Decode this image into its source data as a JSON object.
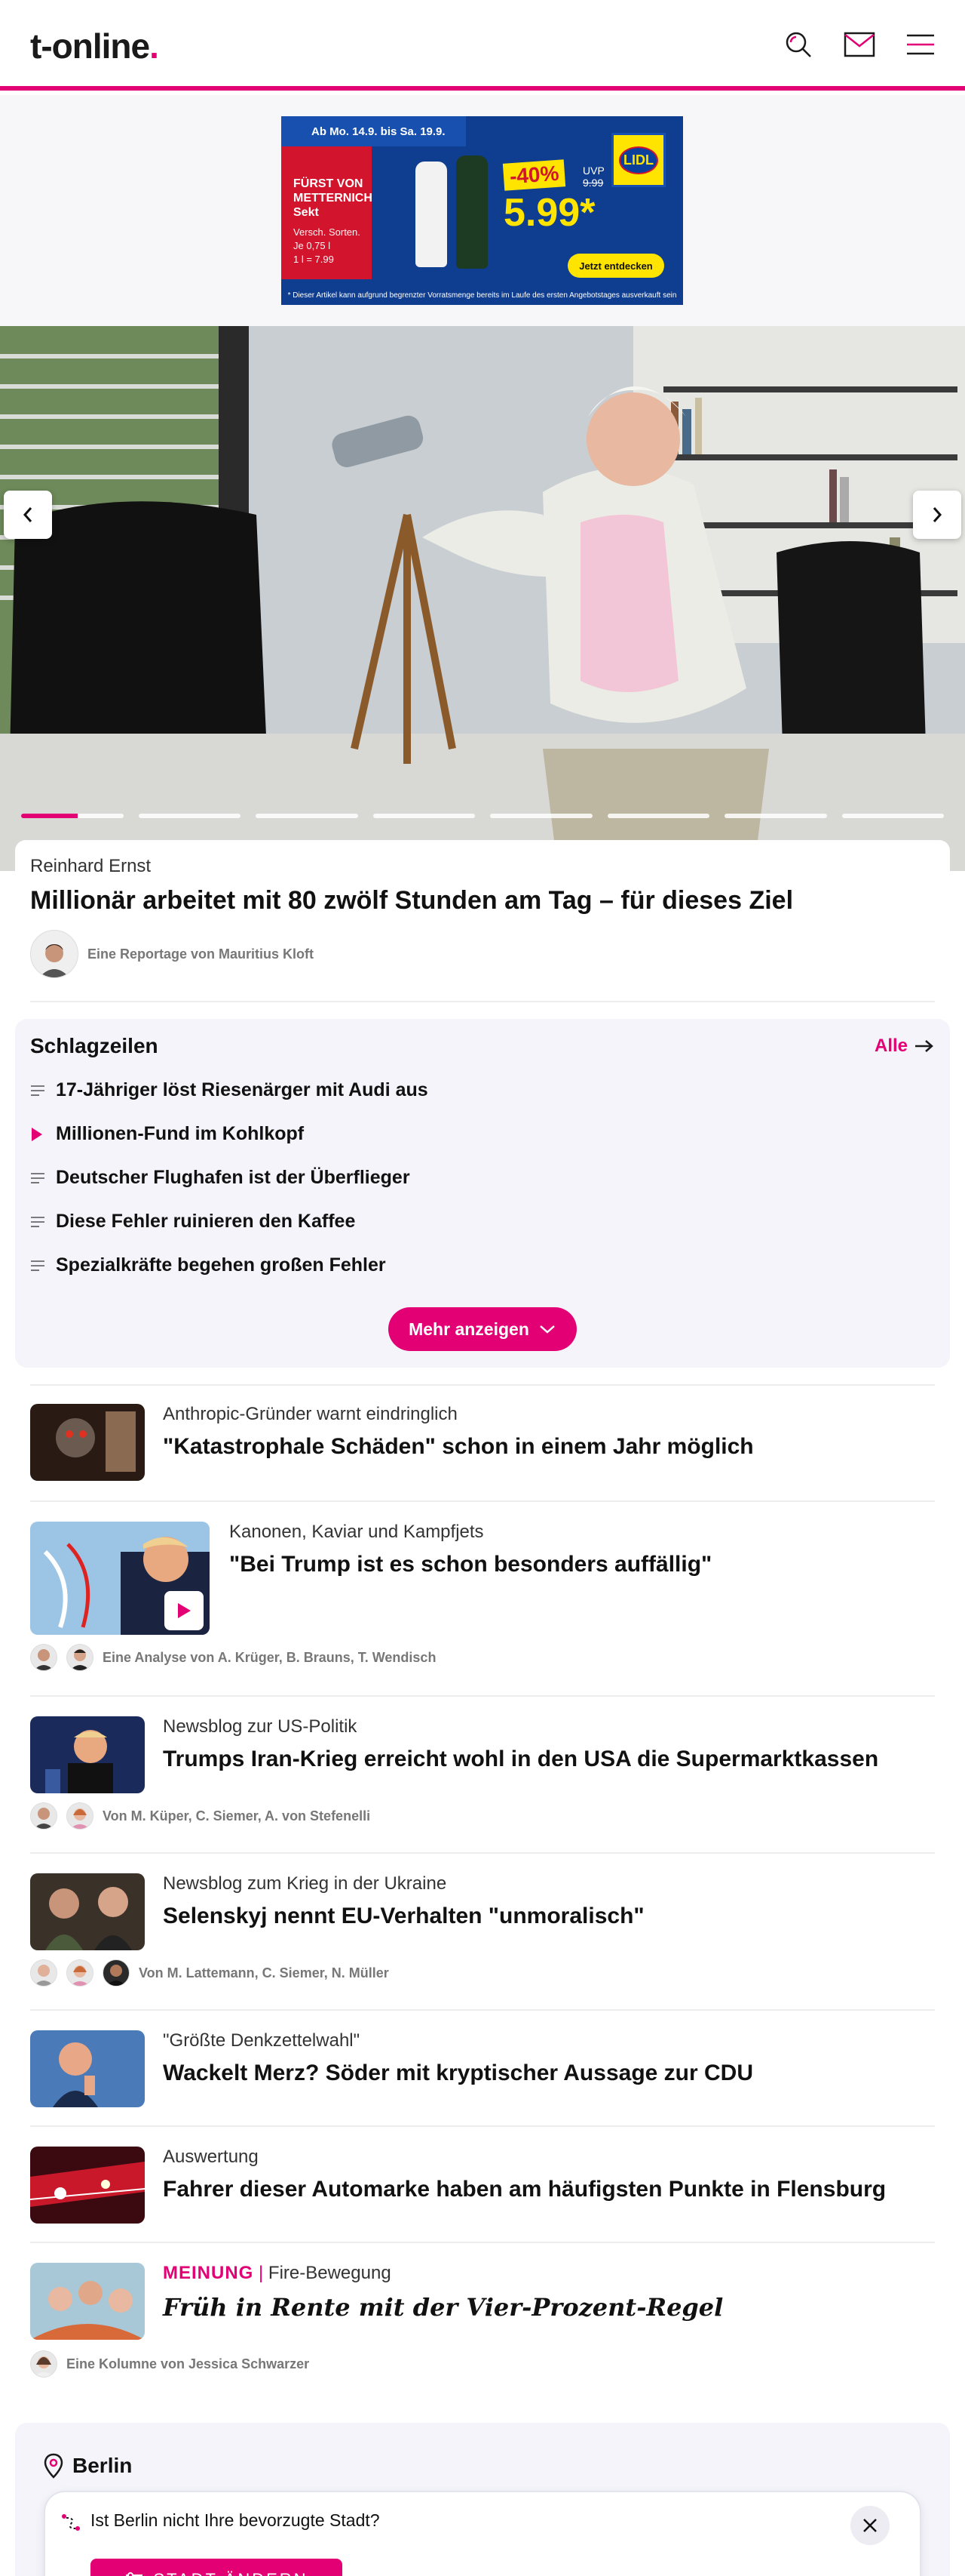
{
  "header": {
    "logo_main": "t-online",
    "logo_dot": ".",
    "icons": [
      "search-icon",
      "mail-icon",
      "menu-icon"
    ],
    "accent": "#e20074"
  },
  "ad": {
    "date_range": "Ab Mo. 14.9. bis Sa. 19.9.",
    "product_name": "FÜRST VON METTERNICH Sekt",
    "product_detail_1": "Versch. Sorten.",
    "product_detail_2": "Je 0,75 l",
    "product_detail_3": "1 l = 7.99",
    "discount": "-40%",
    "uvp_label": "UVP",
    "uvp_old": "9.99",
    "price": "5.99*",
    "brand": "LIDL",
    "cta": "Jetzt entdecken",
    "footnote": "* Dieser Artikel kann aufgrund begrenzter Vorratsmenge bereits im Laufe des ersten Angebotstages ausverkauft sein"
  },
  "hero": {
    "kicker": "Reinhard Ernst",
    "title": "Millionär arbeitet mit 80 zwölf Stunden am Tag – für dieses Ziel",
    "author": "Eine Reportage von Mauritius Kloft",
    "slide_count": 8,
    "active_slide": 1,
    "active_progress": 0.55
  },
  "schlagzeilen": {
    "title": "Schlagzeilen",
    "all_label": "Alle",
    "items": [
      {
        "label": "17-Jähriger löst Riesenärger mit Audi aus",
        "icon": "text-lines-icon"
      },
      {
        "label": "Millionen-Fund im Kohlkopf",
        "icon": "play-icon"
      },
      {
        "label": "Deutscher Flughafen ist der Überflieger",
        "icon": "text-lines-icon"
      },
      {
        "label": "Diese Fehler ruinieren den Kaffee",
        "icon": "text-lines-icon"
      },
      {
        "label": "Spezialkräfte begehen großen Fehler",
        "icon": "text-lines-icon"
      }
    ],
    "more_label": "Mehr anzeigen"
  },
  "articles": [
    {
      "kicker": "Anthropic-Gründer warnt eindringlich",
      "title": "\"Katastrophale Schäden\" schon in einem Jahr möglich"
    },
    {
      "kicker": "Kanonen, Kaviar und Kampfjets",
      "title": "\"Bei Trump ist es schon besonders auffällig\"",
      "author": "Eine Analyse von A. Krüger, B. Brauns, T. Wendisch"
    },
    {
      "kicker": "Newsblog zur US-Politik",
      "title": "Trumps Iran-Krieg erreicht wohl in den USA die Supermarktkassen",
      "author": "Von M. Küper, C. Siemer, A. von Stefenelli"
    },
    {
      "kicker": "Newsblog zum Krieg in der Ukraine",
      "title": "Selenskyj nennt EU-Verhalten \"unmoralisch\"",
      "author": "Von M. Lattemann, C. Siemer, N. Müller"
    },
    {
      "kicker": "\"Größte Denkzettelwahl\"",
      "title": "Wackelt Merz? Söder mit kryptischer Aussage zur CDU"
    },
    {
      "kicker": "Auswertung",
      "title": "Fahrer dieser Automarke haben am häufigsten Punkte in Flensburg"
    },
    {
      "label": "MEINUNG",
      "separator": "|",
      "kicker": "Fire-Bewegung",
      "title": "Früh in Rente mit der Vier-Prozent-Regel",
      "author": "Eine Kolumne von Jessica Schwarzer"
    }
  ],
  "berlin": {
    "title": "Berlin",
    "prompt": "Ist Berlin nicht Ihre bevorzugte Stadt?",
    "button": "STADT ÄNDERN"
  }
}
